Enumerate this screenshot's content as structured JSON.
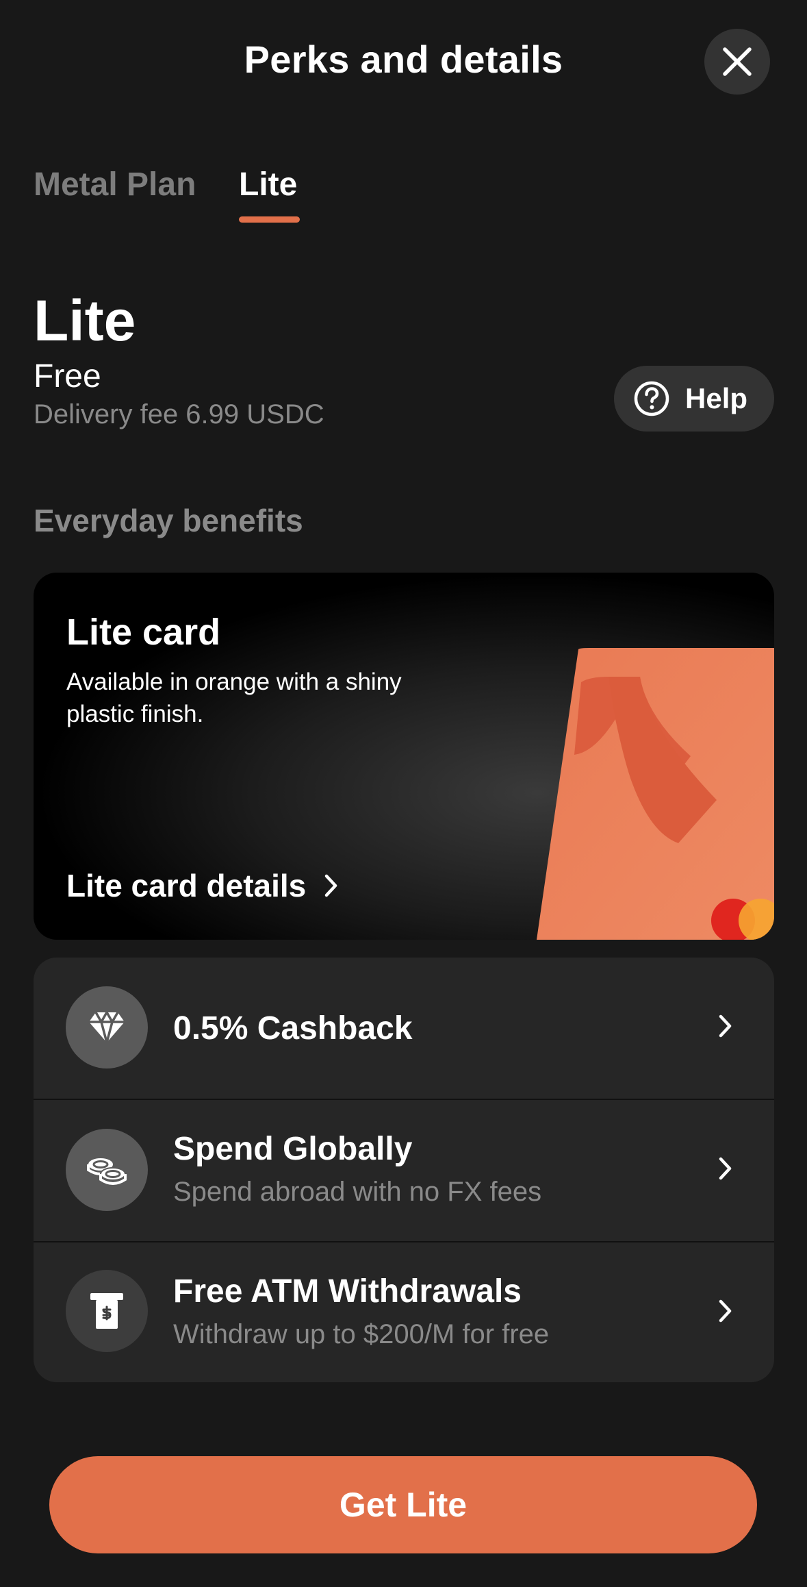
{
  "header": {
    "title": "Perks and details",
    "close_icon": "close-icon"
  },
  "tabs": [
    {
      "label": "Metal Plan",
      "selected": false
    },
    {
      "label": "Lite",
      "selected": true
    }
  ],
  "plan": {
    "name": "Lite",
    "price": "Free",
    "delivery_fee": "Delivery fee 6.99 USDC",
    "help_label": "Help",
    "help_icon": "question-circle-icon"
  },
  "section_title": "Everyday benefits",
  "card_promo": {
    "title": "Lite card",
    "description": "Available in orange with a shiny plastic finish.",
    "link_label": "Lite card details",
    "card_color": "#e8805c"
  },
  "benefits": [
    {
      "title": "0.5% Cashback",
      "subtitle": "",
      "icon": "diamond-icon"
    },
    {
      "title": "Spend Globally",
      "subtitle": "Spend abroad with no FX fees",
      "icon": "coins-icon"
    },
    {
      "title": "Free ATM Withdrawals",
      "subtitle": "Withdraw up to $200/M for free",
      "icon": "atm-icon"
    }
  ],
  "cta": {
    "label": "Get Lite"
  },
  "colors": {
    "background": "#181818",
    "accent": "#e2704a",
    "muted_text": "#8a8a8a",
    "surface": "#262626"
  }
}
